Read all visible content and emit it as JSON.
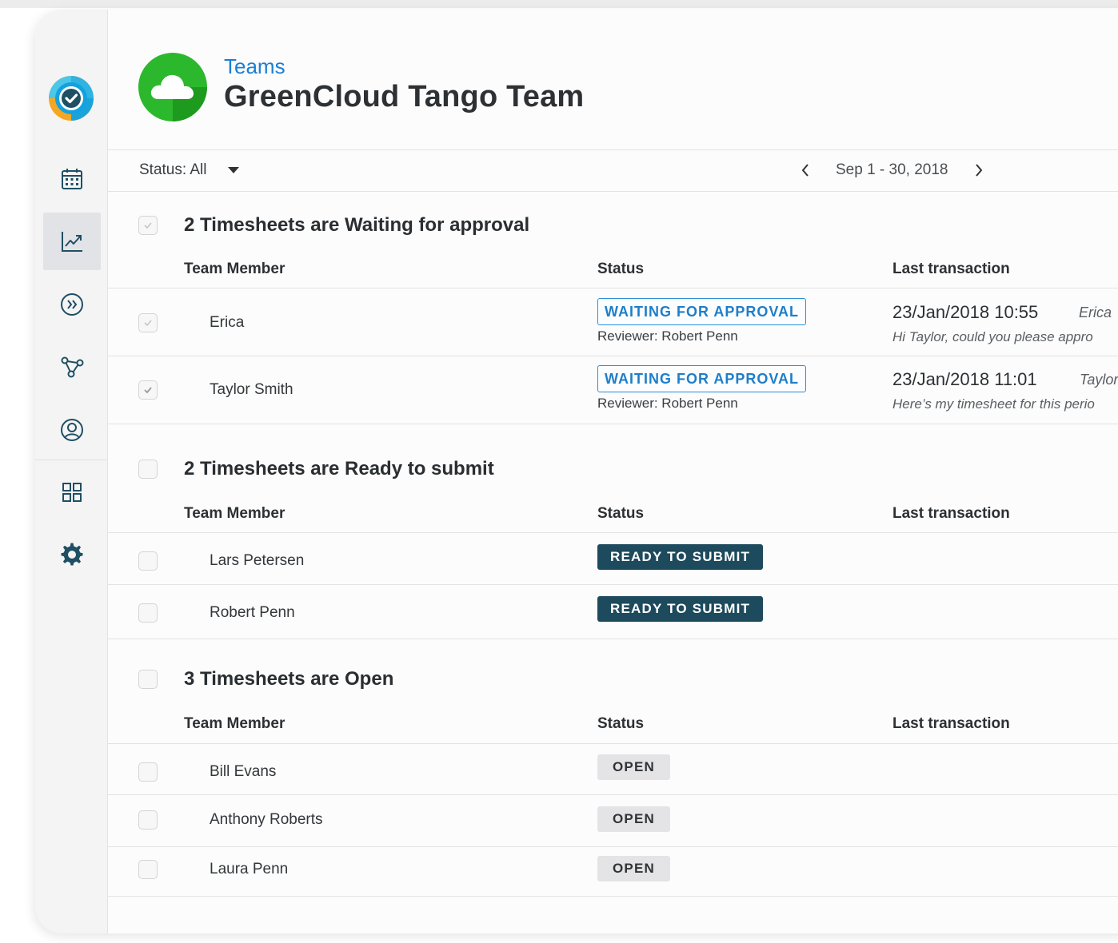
{
  "header": {
    "breadcrumb": "Teams",
    "title": "GreenCloud Tango Team"
  },
  "sidebar": {
    "items": [
      {
        "icon": "calendar-icon"
      },
      {
        "icon": "chart-icon",
        "active": true
      },
      {
        "icon": "fast-forward-icon"
      },
      {
        "icon": "network-icon"
      },
      {
        "icon": "user-icon"
      },
      {
        "icon": "grid-icon"
      },
      {
        "icon": "gear-icon"
      }
    ]
  },
  "toolbar": {
    "status_filter": "Status: All",
    "date_range": "Sep 1 - 30, 2018"
  },
  "columns": {
    "member": "Team Member",
    "status": "Status",
    "last": "Last transaction"
  },
  "sections": [
    {
      "title": "2 Timesheets are Waiting for approval",
      "rows": [
        {
          "name": "Erica",
          "status": "WAITING FOR APPROVAL",
          "reviewer": "Reviewer: Robert Penn",
          "tx_date": "23/Jan/2018 10:55",
          "tx_author": "Erica",
          "tx_message": "Hi Taylor, could you please appro",
          "checked": false
        },
        {
          "name": "Taylor Smith",
          "status": "WAITING FOR APPROVAL",
          "reviewer": "Reviewer: Robert Penn",
          "tx_date": "23/Jan/2018 11:01",
          "tx_author": "Taylor",
          "tx_message": "Here’s my timesheet for this perio",
          "checked": true
        }
      ]
    },
    {
      "title": "2 Timesheets are Ready to submit",
      "rows": [
        {
          "name": "Lars Petersen",
          "status": "READY TO SUBMIT"
        },
        {
          "name": "Robert Penn",
          "status": "READY TO SUBMIT"
        }
      ]
    },
    {
      "title": "3 Timesheets are Open",
      "rows": [
        {
          "name": "Bill Evans",
          "status": "OPEN"
        },
        {
          "name": "Anthony Roberts",
          "status": "OPEN"
        },
        {
          "name": "Laura Penn",
          "status": "OPEN"
        }
      ]
    }
  ],
  "colors": {
    "accent_blue": "#1a7fd6",
    "ready_badge": "#1d4a5c",
    "open_badge": "#e4e4e6",
    "team_green": "#2cb82c"
  }
}
